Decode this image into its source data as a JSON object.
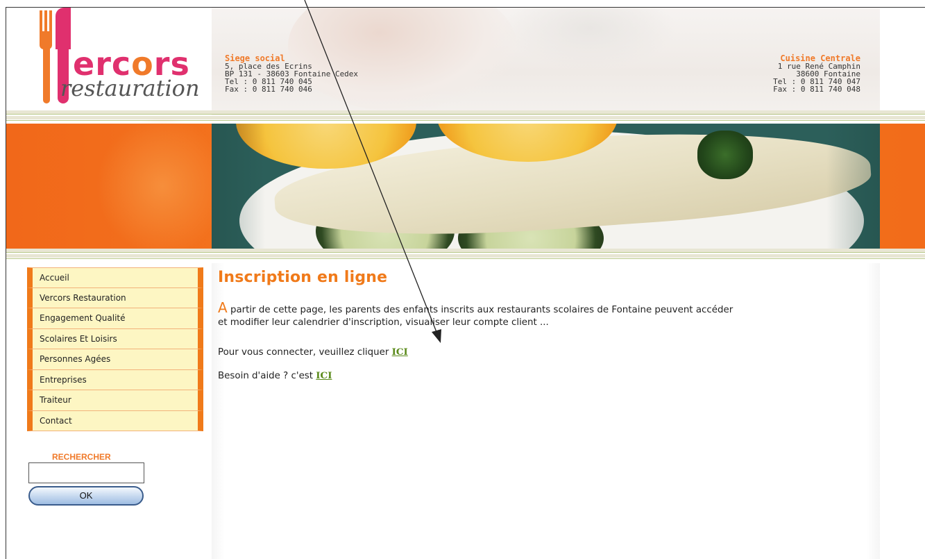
{
  "logo": {
    "brand": "Vercors",
    "brand_prefix": "V",
    "brand_o": "o",
    "brand_rest_1": "erc",
    "brand_rest_2": "rs",
    "sub": "restauration"
  },
  "addresses": {
    "left": {
      "title": "Siege social",
      "lines": [
        "5, place des Ecrins",
        "BP 131 - 38603 Fontaine Cedex",
        "Tel :  0 811 740 045",
        "Fax : 0 811 740 046"
      ]
    },
    "right": {
      "title": "Cuisine Centrale",
      "lines": [
        "1 rue René Camphin",
        "38600 Fontaine",
        "Tel : 0 811 740 047",
        "Fax : 0 811 740 048"
      ]
    }
  },
  "menu": {
    "items": [
      {
        "label": "Accueil"
      },
      {
        "label": "Vercors Restauration"
      },
      {
        "label": "Engagement Qualité"
      },
      {
        "label": "Scolaires Et Loisirs"
      },
      {
        "label": "Personnes Agées"
      },
      {
        "label": "Entreprises"
      },
      {
        "label": "Traiteur"
      },
      {
        "label": "Contact"
      }
    ]
  },
  "search": {
    "label": "RECHERCHER",
    "value": "",
    "button": "OK"
  },
  "content": {
    "title": "Inscription en ligne",
    "intro_cap": "A",
    "intro_line1": " partir de cette page, les parents des enfants inscrits aux restaurants scolaires de Fontaine peuvent accéder",
    "intro_line2": "et modifier leur calendrier d'inscription, visualiser leur compte client ...",
    "connect_text": "Pour vous connecter, veuillez cliquer ",
    "connect_link": "ICI",
    "help_text": "Besoin d'aide ? c'est ",
    "help_link": "ICI"
  },
  "colors": {
    "orange": "#f07a1a",
    "pink": "#e0306e",
    "menu_bg": "#fdf6c3",
    "link_green": "#5a8a1a"
  }
}
